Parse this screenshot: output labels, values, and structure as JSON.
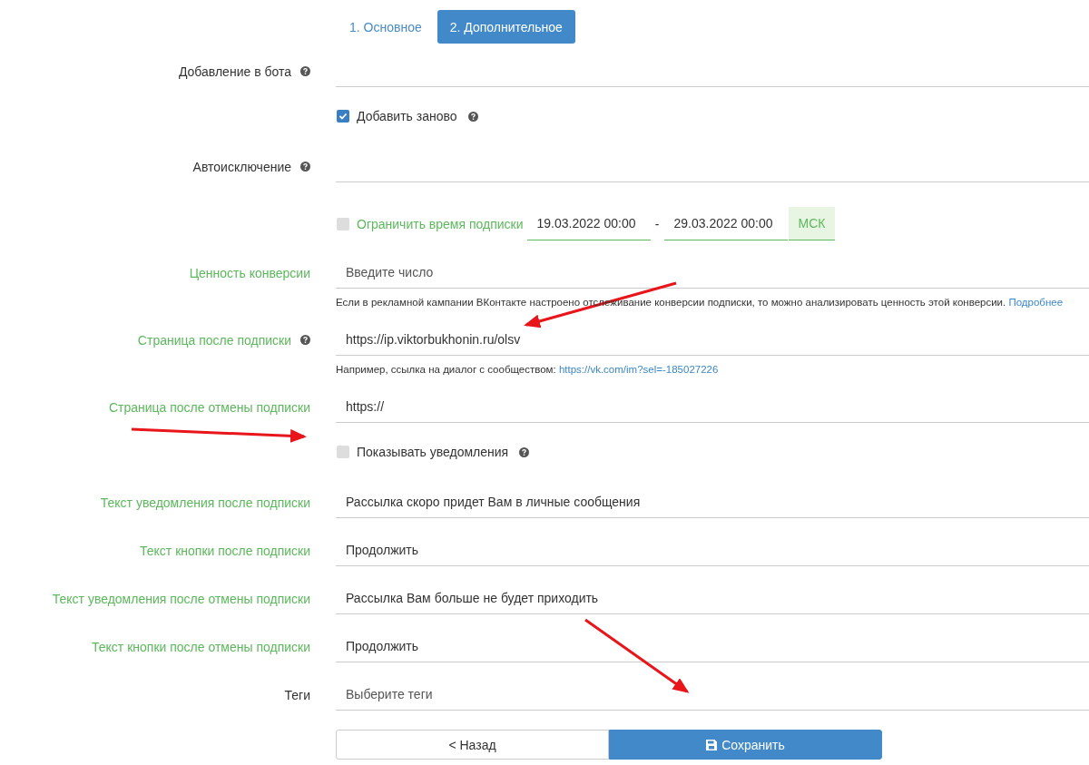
{
  "tabs": [
    {
      "label": "1. Основное",
      "selected": false
    },
    {
      "label": "2. Дополнительное",
      "selected": true
    }
  ],
  "rows": [
    {
      "kind": "field",
      "label": "Добавление в бота",
      "color": "#333333",
      "help": true
    },
    {
      "kind": "checkbox",
      "label": "Добавить заново",
      "checked": true,
      "help": true
    },
    {
      "kind": "field",
      "label": "Автоисключение",
      "color": "#333333",
      "help": true
    },
    {
      "kind": "daterange",
      "label": "Ограничить время подписки",
      "checked": false,
      "from": "19.03.2022 00:00",
      "separator": "-",
      "to": "29.03.2022 00:00",
      "addon": "МСК"
    },
    {
      "kind": "field",
      "label": "Ценность конверсии",
      "color": "#5cb85c",
      "help": false,
      "placeholder": "Введите число",
      "hint": "Если в рекламной кампании ВКонтакте настроено отслеживание конверсии подписки, то можно анализировать ценность этой конверсии.",
      "hint_link": "Подробнее"
    },
    {
      "kind": "field",
      "label": "Страница после подписки",
      "color": "#5cb85c",
      "help": true,
      "value": "https://ip.viktorbukhonin.ru/olsv",
      "hint": "Например, ссылка на диалог с сообществом:",
      "hint_link": "https://vk.com/im?sel=-185027226"
    },
    {
      "kind": "field",
      "label": "Страница после отмены подписки",
      "color": "#5cb85c",
      "help": false,
      "value": "https://"
    },
    {
      "kind": "checkbox",
      "label": "Показывать уведомления",
      "checked": false,
      "help": true
    },
    {
      "kind": "field",
      "label": "Текст уведомления после подписки",
      "color": "#5cb85c",
      "help": false,
      "value": "Рассылка скоро придет Вам в личные сообщения"
    },
    {
      "kind": "field",
      "label": "Текст кнопки после подписки",
      "color": "#5cb85c",
      "help": false,
      "value": "Продолжить"
    },
    {
      "kind": "field",
      "label": "Текст уведомления после отмены подписки",
      "color": "#5cb85c",
      "help": false,
      "value": "Рассылка Вам больше не будет приходить"
    },
    {
      "kind": "field",
      "label": "Текст кнопки после отмены подписки",
      "color": "#5cb85c",
      "help": false,
      "value": "Продолжить"
    },
    {
      "kind": "field",
      "label": "Теги",
      "color": "#333333",
      "help": false,
      "placeholder": "Выберите теги"
    }
  ],
  "buttons": {
    "back": "< Назад",
    "save": "Сохранить"
  }
}
